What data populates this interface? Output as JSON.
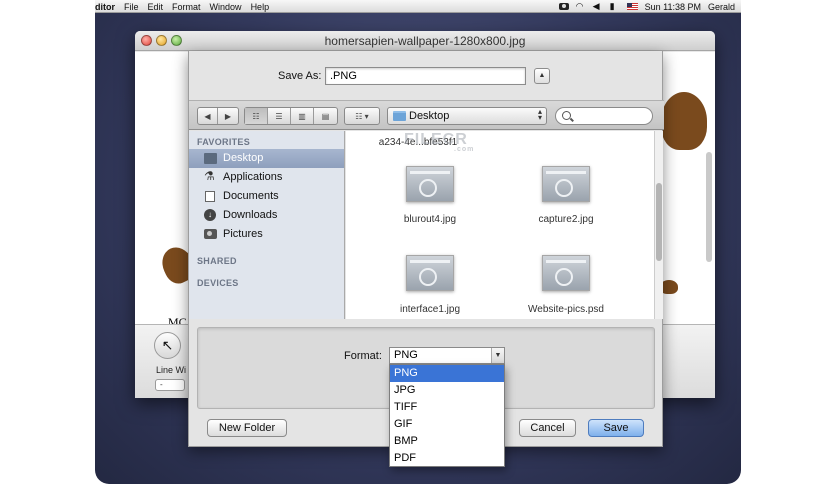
{
  "menubar": {
    "app_name": "ditor",
    "items": [
      "File",
      "Edit",
      "Format",
      "Window",
      "Help"
    ],
    "clock": "Sun 11:38 PM",
    "user": "Gerald"
  },
  "window": {
    "title": "homersapien-wallpaper-1280x800.jpg",
    "doc_text": "MC",
    "line_width_label": "Line Wi",
    "line_width_value": "-"
  },
  "save_dialog": {
    "save_as_label": "Save As:",
    "filename_value": ".PNG",
    "location": "Desktop",
    "sidebar": {
      "favorites_header": "FAVORITES",
      "items": [
        {
          "label": "Desktop",
          "icon": "desktop-icon",
          "selected": true
        },
        {
          "label": "Applications",
          "icon": "applications-icon",
          "selected": false
        },
        {
          "label": "Documents",
          "icon": "documents-icon",
          "selected": false
        },
        {
          "label": "Downloads",
          "icon": "downloads-icon",
          "selected": false
        },
        {
          "label": "Pictures",
          "icon": "pictures-icon",
          "selected": false
        }
      ],
      "shared_header": "SHARED",
      "devices_header": "DEVICES"
    },
    "files": [
      {
        "name": "a234-4e...bfe53f1"
      },
      {
        "name": "blurout4.jpg"
      },
      {
        "name": "capture2.jpg"
      },
      {
        "name": "interface1.jpg"
      },
      {
        "name": "Website-pics.psd"
      }
    ],
    "watermark": "FILECR",
    "watermark_sub": ".com",
    "format_label": "Format:",
    "format_selected": "PNG",
    "format_options": [
      "PNG",
      "JPG",
      "TIFF",
      "GIF",
      "BMP",
      "PDF"
    ],
    "new_folder_label": "New Folder",
    "cancel_label": "Cancel",
    "save_label": "Save"
  },
  "colors": {
    "selection_blue": "#3a74d6",
    "sidebar_selected": "#8e9fbd",
    "primary_button": "#7fb0ec"
  }
}
